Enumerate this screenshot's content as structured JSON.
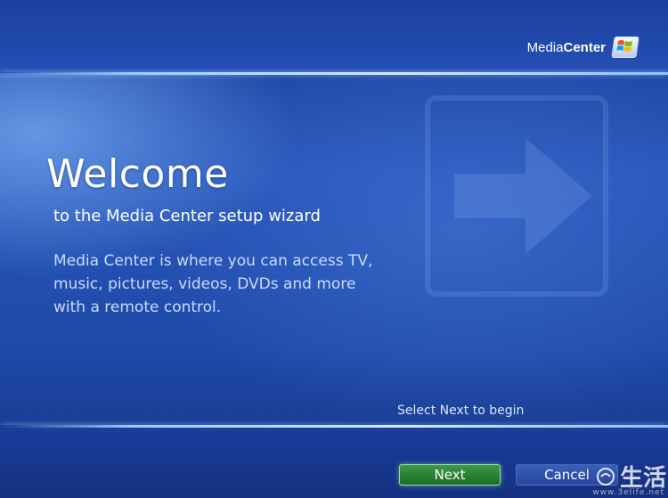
{
  "header": {
    "brand_part1": "Media",
    "brand_part2": "Center",
    "logo_icon": "windows-flag-icon"
  },
  "main": {
    "title": "Welcome",
    "subtitle": "to the Media Center setup wizard",
    "description": "Media Center is where you can access TV, music, pictures, videos, DVDs and more with a remote control.",
    "background_icon": "arrow-right-icon"
  },
  "footer": {
    "hint": "Select Next to begin",
    "next_label": "Next",
    "cancel_label": "Cancel"
  },
  "watermark": {
    "text": "生活",
    "url": "www.3elife.net"
  },
  "colors": {
    "background": "#2755b9",
    "accent_line": "#cfe6ff",
    "next_button": "#2b7f34",
    "cancel_button": "#2f5bb0",
    "description_text": "#c9dcfb"
  }
}
